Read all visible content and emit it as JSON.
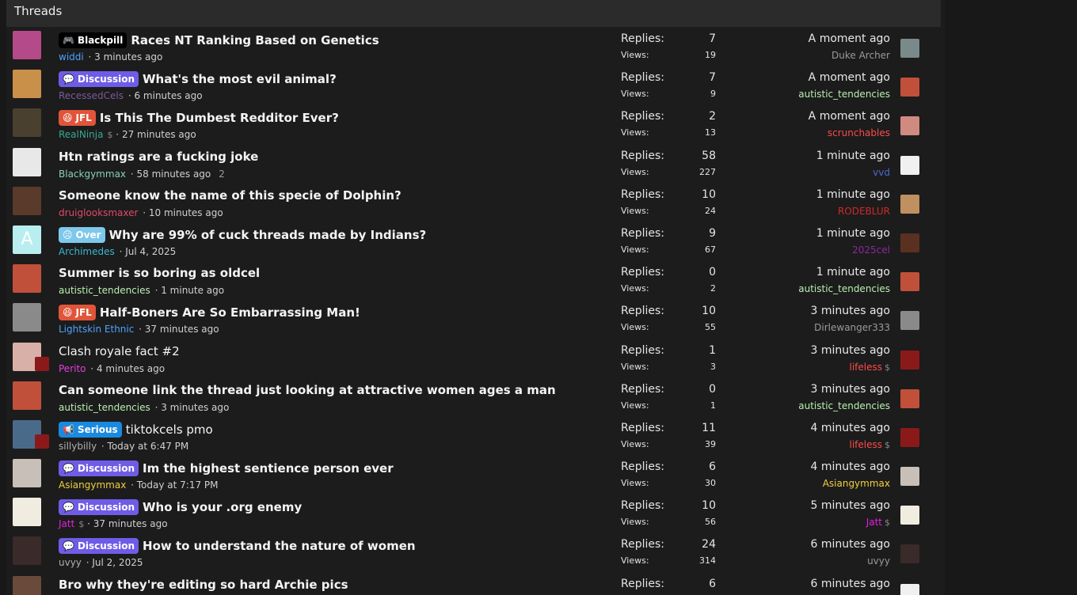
{
  "header": {
    "title": "Threads"
  },
  "labels": {
    "replies": "Replies:",
    "views": "Views:"
  },
  "threads": [
    {
      "prefix": {
        "label": "Blackpill",
        "icon": "game-icon",
        "glyph": "🎮",
        "bg": "#000000"
      },
      "title": "Races NT Ranking Based on Genetics",
      "bold": true,
      "author": "widdi",
      "author_color": "#4aa3ff",
      "started": "3 minutes ago",
      "pages": "",
      "replies": "7",
      "views": "19",
      "last_time": "A moment ago",
      "last_user": "Duke Archer",
      "last_color": "#9a9a9a",
      "avatar_color": "#b44a8a",
      "last_avatar_color": "#7a8a8a"
    },
    {
      "prefix": {
        "label": "Discussion",
        "icon": "chat-icon",
        "glyph": "💬",
        "bg": "#6f5ce6"
      },
      "title": "What's the most evil animal?",
      "bold": true,
      "author": "RecessedCels",
      "author_color": "#7a5a9a",
      "started": "6 minutes ago",
      "pages": "",
      "replies": "7",
      "views": "9",
      "last_time": "A moment ago",
      "last_user": "autistic_tendencies",
      "last_color": "#b8f0b0",
      "avatar_color": "#c9904a",
      "last_avatar_color": "#c0503a"
    },
    {
      "prefix": {
        "label": "JFL",
        "icon": "laugh-icon",
        "glyph": "😆",
        "bg": "#e0553a"
      },
      "title": "Is This The Dumbest Redditor Ever?",
      "bold": true,
      "author": "RealNinja",
      "author_color": "#3aa890",
      "started": "27 minutes ago",
      "pages": "",
      "dollar": true,
      "replies": "2",
      "views": "13",
      "last_time": "A moment ago",
      "last_user": "scrunchables",
      "last_color": "#ff4a4a",
      "avatar_color": "#4a4030",
      "last_avatar_color": "#d08a80"
    },
    {
      "prefix": null,
      "title": "Htn ratings are a fucking joke",
      "bold": true,
      "author": "Blackgymmax",
      "author_color": "#8ad0b8",
      "started": "58 minutes ago",
      "pages": "2",
      "replies": "58",
      "views": "227",
      "last_time": "1 minute ago",
      "last_user": "vvd",
      "last_color": "#4a6ad0",
      "avatar_color": "#e8e8e8",
      "last_avatar_color": "#f0f0f0"
    },
    {
      "prefix": null,
      "title": "Someone know the name of this specie of Dolphin?",
      "bold": true,
      "author": "druiglooksmaxer",
      "author_color": "#e04a6a",
      "started": "10 minutes ago",
      "pages": "",
      "replies": "10",
      "views": "24",
      "last_time": "1 minute ago",
      "last_user": "RODEBLUR",
      "last_color": "#d02a2a",
      "avatar_color": "#5a3a2a",
      "last_avatar_color": "#c09060"
    },
    {
      "prefix": {
        "label": "Over",
        "icon": "sad-face-icon",
        "glyph": "☹",
        "bg": "#7ec8ec"
      },
      "title": "Why are 99% of cuck threads made by Indians?",
      "bold": true,
      "author": "Archimedes",
      "author_color": "#3ab8d0",
      "started": "Jul 4, 2025",
      "pages": "",
      "replies": "9",
      "views": "67",
      "last_time": "1 minute ago",
      "last_user": "2025cel",
      "last_color": "#8a2a9a",
      "avatar_color": "#b8eef0",
      "avatar_letter": "A",
      "last_avatar_color": "#5a3020"
    },
    {
      "prefix": null,
      "title": "Summer is so boring as oldcel",
      "bold": true,
      "author": "autistic_tendencies",
      "author_color": "#b8f0b0",
      "started": "1 minute ago",
      "pages": "",
      "replies": "0",
      "views": "2",
      "last_time": "1 minute ago",
      "last_user": "autistic_tendencies",
      "last_color": "#b8f0b0",
      "avatar_color": "#c0503a",
      "last_avatar_color": "#c0503a"
    },
    {
      "prefix": {
        "label": "JFL",
        "icon": "laugh-icon",
        "glyph": "😆",
        "bg": "#e0553a"
      },
      "title": "Half-Boners Are So Embarrassing Man!",
      "bold": true,
      "author": "Lightskin Ethnic",
      "author_color": "#4aa3ff",
      "started": "37 minutes ago",
      "pages": "",
      "replies": "10",
      "views": "55",
      "last_time": "3 minutes ago",
      "last_user": "Dirlewanger333",
      "last_color": "#9a9a9a",
      "avatar_color": "#8a8a8a",
      "last_avatar_color": "#8a8a8a"
    },
    {
      "prefix": null,
      "title": "Clash royale fact #2",
      "bold": false,
      "author": "Perito",
      "author_color": "#e040e0",
      "started": "4 minutes ago",
      "pages": "",
      "replies": "1",
      "views": "3",
      "last_time": "3 minutes ago",
      "last_user": "lifeless",
      "last_color": "#ff4a4a",
      "last_dollar": true,
      "avatar_color": "#d8b0a8",
      "last_avatar_color": "#8a1a1a",
      "sub_avatar": true
    },
    {
      "prefix": null,
      "title": "Can someone link the thread just looking at attractive women ages a man",
      "bold": true,
      "author": "autistic_tendencies",
      "author_color": "#b8f0b0",
      "started": "3 minutes ago",
      "pages": "",
      "replies": "0",
      "views": "1",
      "last_time": "3 minutes ago",
      "last_user": "autistic_tendencies",
      "last_color": "#b8f0b0",
      "avatar_color": "#c0503a",
      "last_avatar_color": "#c0503a"
    },
    {
      "prefix": {
        "label": "Serious",
        "icon": "megaphone-icon",
        "glyph": "📢",
        "bg": "#1a8ae0"
      },
      "title": "tiktokcels pmo",
      "bold": false,
      "author": "sillybilly",
      "author_color": "#b0b0b0",
      "started": "Today at 6:47 PM",
      "pages": "",
      "replies": "11",
      "views": "39",
      "last_time": "4 minutes ago",
      "last_user": "lifeless",
      "last_color": "#ff4a4a",
      "last_dollar": true,
      "avatar_color": "#4a6a8a",
      "last_avatar_color": "#8a1a1a",
      "sub_avatar": true
    },
    {
      "prefix": {
        "label": "Discussion",
        "icon": "chat-icon",
        "glyph": "💬",
        "bg": "#6f5ce6"
      },
      "title": "Im the highest sentience person ever",
      "bold": true,
      "author": "Asiangymmax",
      "author_color": "#f0d040",
      "started": "Today at 7:17 PM",
      "pages": "",
      "replies": "6",
      "views": "30",
      "last_time": "4 minutes ago",
      "last_user": "Asiangymmax",
      "last_color": "#f0d040",
      "avatar_color": "#c8c0b8",
      "last_avatar_color": "#c8c0b8"
    },
    {
      "prefix": {
        "label": "Discussion",
        "icon": "chat-icon",
        "glyph": "💬",
        "bg": "#6f5ce6"
      },
      "title": "Who is your .org enemy",
      "bold": true,
      "author": "Jatt",
      "author_color": "#e020e0",
      "started": "37 minutes ago",
      "pages": "",
      "dollar": true,
      "replies": "10",
      "views": "56",
      "last_time": "5 minutes ago",
      "last_user": "Jatt",
      "last_color": "#e020e0",
      "last_dollar": true,
      "avatar_color": "#f0ece0",
      "last_avatar_color": "#f0ece0"
    },
    {
      "prefix": {
        "label": "Discussion",
        "icon": "chat-icon",
        "glyph": "💬",
        "bg": "#6f5ce6"
      },
      "title": "How to understand the nature of women",
      "bold": true,
      "author": "uvyy",
      "author_color": "#b0b0b0",
      "started": "Jul 2, 2025",
      "pages": "",
      "replies": "24",
      "views": "314",
      "last_time": "6 minutes ago",
      "last_user": "uvyy",
      "last_color": "#9a9a9a",
      "avatar_color": "#3a2a2a",
      "last_avatar_color": "#3a2a2a"
    },
    {
      "prefix": null,
      "title": "Bro why they're editing so hard Archie pics",
      "bold": true,
      "author": "",
      "author_color": "#b0b0b0",
      "started": "",
      "pages": "",
      "replies": "6",
      "views": "",
      "last_time": "6 minutes ago",
      "last_user": "",
      "last_color": "#9a9a9a",
      "avatar_color": "#6a4a3a",
      "last_avatar_color": "#f0f0f0"
    }
  ]
}
